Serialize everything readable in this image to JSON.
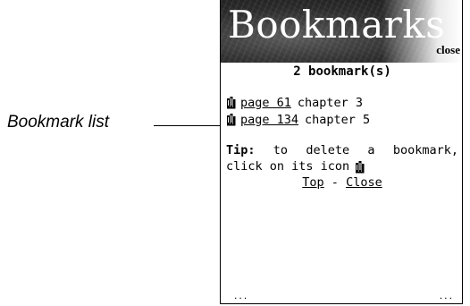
{
  "callout": {
    "label": "Bookmark list"
  },
  "device": {
    "banner_title": "Bookmarks",
    "close_label": "close",
    "count_text": "2 bookmark(s)",
    "bookmarks": [
      {
        "icon": "bookmark-icon",
        "link_text": "page 61",
        "chapter": "chapter 3"
      },
      {
        "icon": "bookmark-icon",
        "link_text": "page 134",
        "chapter": "chapter 5"
      }
    ],
    "tip": {
      "label": "Tip:",
      "line1_words": [
        "to",
        "delete",
        "a",
        "bookmark,"
      ],
      "line2_text": "click on its icon"
    },
    "nav": {
      "top_label": "Top",
      "separator": " - ",
      "close_label": "Close"
    },
    "footer": {
      "left": "...",
      "right": "..."
    }
  }
}
